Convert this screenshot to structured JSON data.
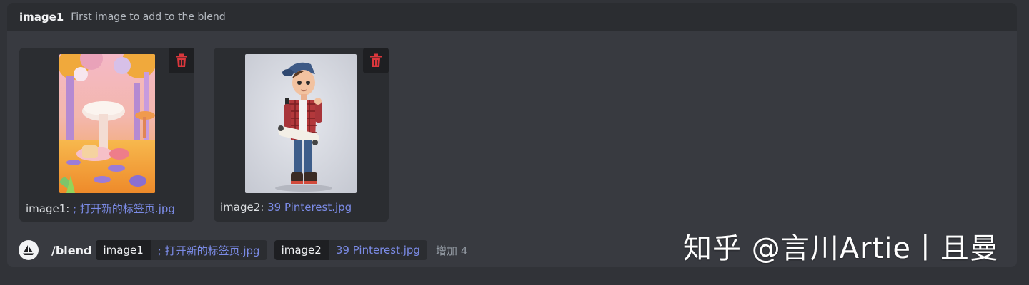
{
  "option_header": {
    "name": "image1",
    "description": "First image to add to the blend"
  },
  "attachments": [
    {
      "caption_label": "image1:",
      "caption_file": "; 打开新的标签页.jpg",
      "thumbnail_icon": "mushroom-scene-image",
      "delete_icon": "trash-icon"
    },
    {
      "caption_label": "image2:",
      "caption_file": "39 Pinterest.jpg",
      "thumbnail_icon": "skateboarder-character-image",
      "delete_icon": "trash-icon"
    }
  ],
  "command": {
    "bot_icon": "sailboat-icon",
    "name": "/blend",
    "options": [
      {
        "key": "image1",
        "value": "; 打开新的标签页.jpg"
      },
      {
        "key": "image2",
        "value": "39 Pinterest.jpg"
      }
    ],
    "more_label": "增加 4"
  },
  "watermark": "知乎 @言川Artie丨且曼",
  "colors": {
    "background": "#313338",
    "panel": "#383a40",
    "header": "#2b2d31",
    "link": "#7b8be6",
    "delete": "#da373c"
  }
}
